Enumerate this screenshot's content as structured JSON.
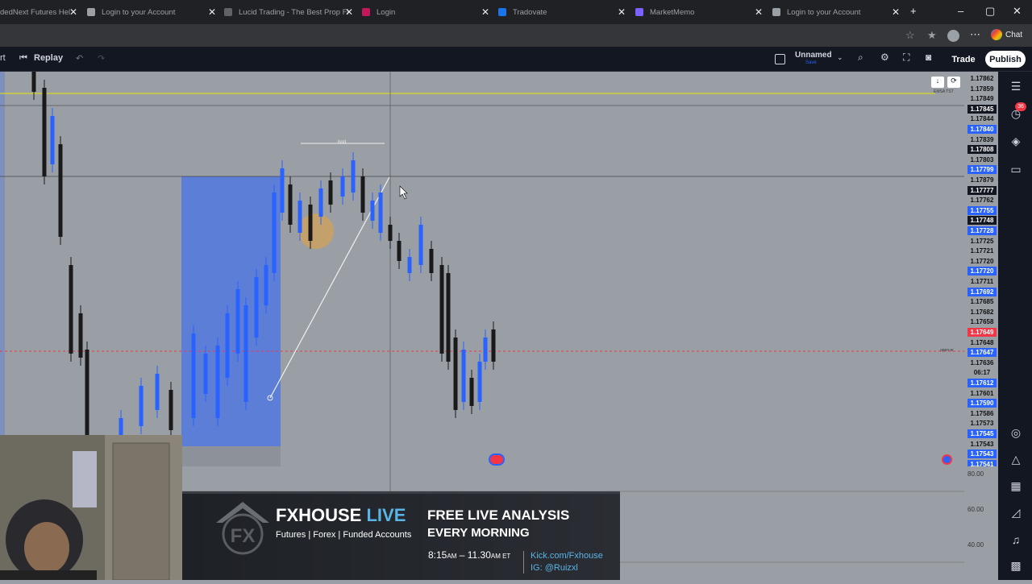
{
  "browser": {
    "tabs": [
      {
        "title": "dedNext Futures Hel",
        "color": "#f4b400"
      },
      {
        "title": "Login to your Account",
        "color": "#9aa0a6"
      },
      {
        "title": "Lucid Trading - The Best Prop Fi",
        "color": "#5f6368"
      },
      {
        "title": "Login",
        "color": "#c2185b"
      },
      {
        "title": "Tradovate",
        "color": "#1a73e8"
      },
      {
        "title": "MarketMemo",
        "color": "#7b61ff"
      },
      {
        "title": "Login to your Account",
        "color": "#9aa0a6"
      }
    ],
    "chat_label": "Chat"
  },
  "toolbar": {
    "left_fragment": "rt",
    "replay_label": "Replay",
    "layout_name": "Unnamed",
    "layout_sub": "Save",
    "trade_label": "Trade",
    "publish_label": "Publish"
  },
  "chart": {
    "hod_label": "hod",
    "emsa_label": "EMSA TST",
    "open_label": "open-w",
    "colors": {
      "bull": "#2962ff",
      "bear": "#1a1a1a",
      "zone": "#2962ff",
      "accent": "#f23645"
    }
  },
  "price_labels": [
    {
      "v": "1.17862",
      "s": ""
    },
    {
      "v": "1.17859",
      "s": ""
    },
    {
      "v": "1.17849",
      "s": ""
    },
    {
      "v": "1.17845",
      "s": "k"
    },
    {
      "v": "1.17844",
      "s": ""
    },
    {
      "v": "1.17840",
      "s": "b"
    },
    {
      "v": "1.17839",
      "s": ""
    },
    {
      "v": "1.17808",
      "s": "k"
    },
    {
      "v": "1.17803",
      "s": ""
    },
    {
      "v": "1.17799",
      "s": "b"
    },
    {
      "v": "1.17879",
      "s": ""
    },
    {
      "v": "1.17777",
      "s": "k"
    },
    {
      "v": "1.17762",
      "s": ""
    },
    {
      "v": "1.17755",
      "s": "b"
    },
    {
      "v": "1.17748",
      "s": "k"
    },
    {
      "v": "1.17728",
      "s": "b"
    },
    {
      "v": "1.17725",
      "s": ""
    },
    {
      "v": "1.17721",
      "s": ""
    },
    {
      "v": "1.17720",
      "s": ""
    },
    {
      "v": "1.17720",
      "s": "b"
    },
    {
      "v": "1.17711",
      "s": ""
    },
    {
      "v": "1.17692",
      "s": "b"
    },
    {
      "v": "1.17685",
      "s": ""
    },
    {
      "v": "1.17682",
      "s": ""
    },
    {
      "v": "1.17658",
      "s": ""
    },
    {
      "v": "1.17649",
      "s": "r"
    },
    {
      "v": "1.17648",
      "s": ""
    },
    {
      "v": "1.17647",
      "s": "b"
    },
    {
      "v": "1.17636",
      "s": ""
    },
    {
      "v": "06:17",
      "s": ""
    },
    {
      "v": "1.17612",
      "s": "b"
    },
    {
      "v": "1.17601",
      "s": ""
    },
    {
      "v": "1.17590",
      "s": "b"
    },
    {
      "v": "1.17586",
      "s": ""
    },
    {
      "v": "1.17573",
      "s": ""
    },
    {
      "v": "1.17545",
      "s": "b"
    },
    {
      "v": "1.17543",
      "s": ""
    },
    {
      "v": "1.17543",
      "s": "b"
    },
    {
      "v": "1.17541",
      "s": "b"
    }
  ],
  "oscillator_levels": [
    "80.00",
    "60.00",
    "40.00"
  ],
  "notification_count": "36",
  "banner": {
    "brand": "FXHOUSE",
    "brand_live": "LIVE",
    "tagline": "Futures | Forex | Funded Accounts",
    "headline_1": "FREE LIVE ANALYSIS",
    "headline_2": "EVERY MORNING",
    "time_start": "8:15",
    "time_start_suffix": "AM",
    "time_dash": "–",
    "time_end": "11.30",
    "time_end_suffix": "AM ET",
    "kick": "Kick.com/Fxhouse",
    "ig": "IG: @Ruizxl"
  }
}
